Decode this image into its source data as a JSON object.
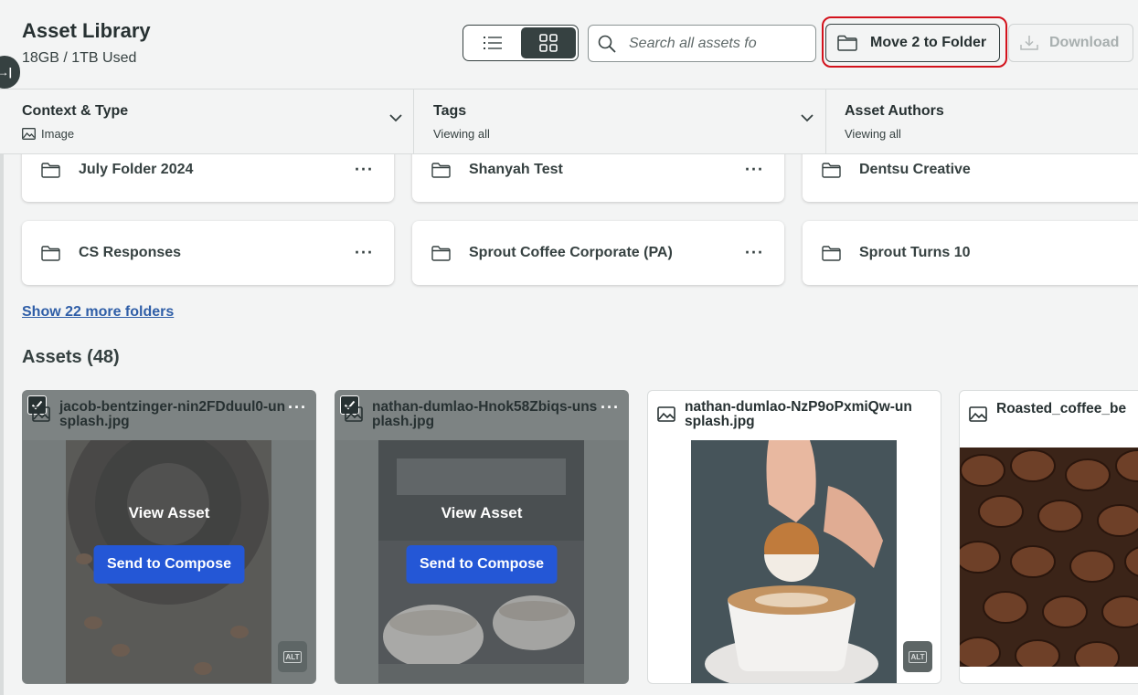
{
  "header": {
    "title": "Asset Library",
    "usage": "18GB / 1TB Used",
    "search_placeholder": "Search all assets fo",
    "move_label": "Move 2 to Folder",
    "download_label": "Download"
  },
  "collapse_glyph": "→|",
  "filters": [
    {
      "title": "Context & Type",
      "value": "Image"
    },
    {
      "title": "Tags",
      "value": "Viewing all"
    },
    {
      "title": "Asset Authors",
      "value": "Viewing all"
    }
  ],
  "folders": [
    {
      "name": "July Folder 2024"
    },
    {
      "name": "Shanyah Test"
    },
    {
      "name": "Dentsu Creative"
    },
    {
      "name": "CS Responses"
    },
    {
      "name": "Sprout Coffee Corporate (PA)"
    },
    {
      "name": "Sprout Turns 10"
    }
  ],
  "more_folders_link": "Show 22 more folders",
  "assets_heading": "Assets (48)",
  "assets": [
    {
      "title": "jacob-bentzinger-nin2FDduul0-unsplash.jpg",
      "selected": true,
      "alt_badge": "ALT"
    },
    {
      "title": "nathan-dumlao-Hnok58Zbiqs-unsplash.jpg",
      "selected": true,
      "alt_badge": ""
    },
    {
      "title": "nathan-dumlao-NzP9oPxmiQw-unsplash.jpg",
      "selected": false,
      "alt_badge": "ALT"
    },
    {
      "title": "Roasted_coffee_be",
      "selected": false,
      "alt_badge": ""
    }
  ],
  "overlay": {
    "view_label": "View Asset",
    "compose_label": "Send to Compose"
  },
  "menu_glyph": "···",
  "colors": {
    "accent_blue": "#2457d6",
    "highlight_red": "#d3121c",
    "dark": "#364141"
  }
}
